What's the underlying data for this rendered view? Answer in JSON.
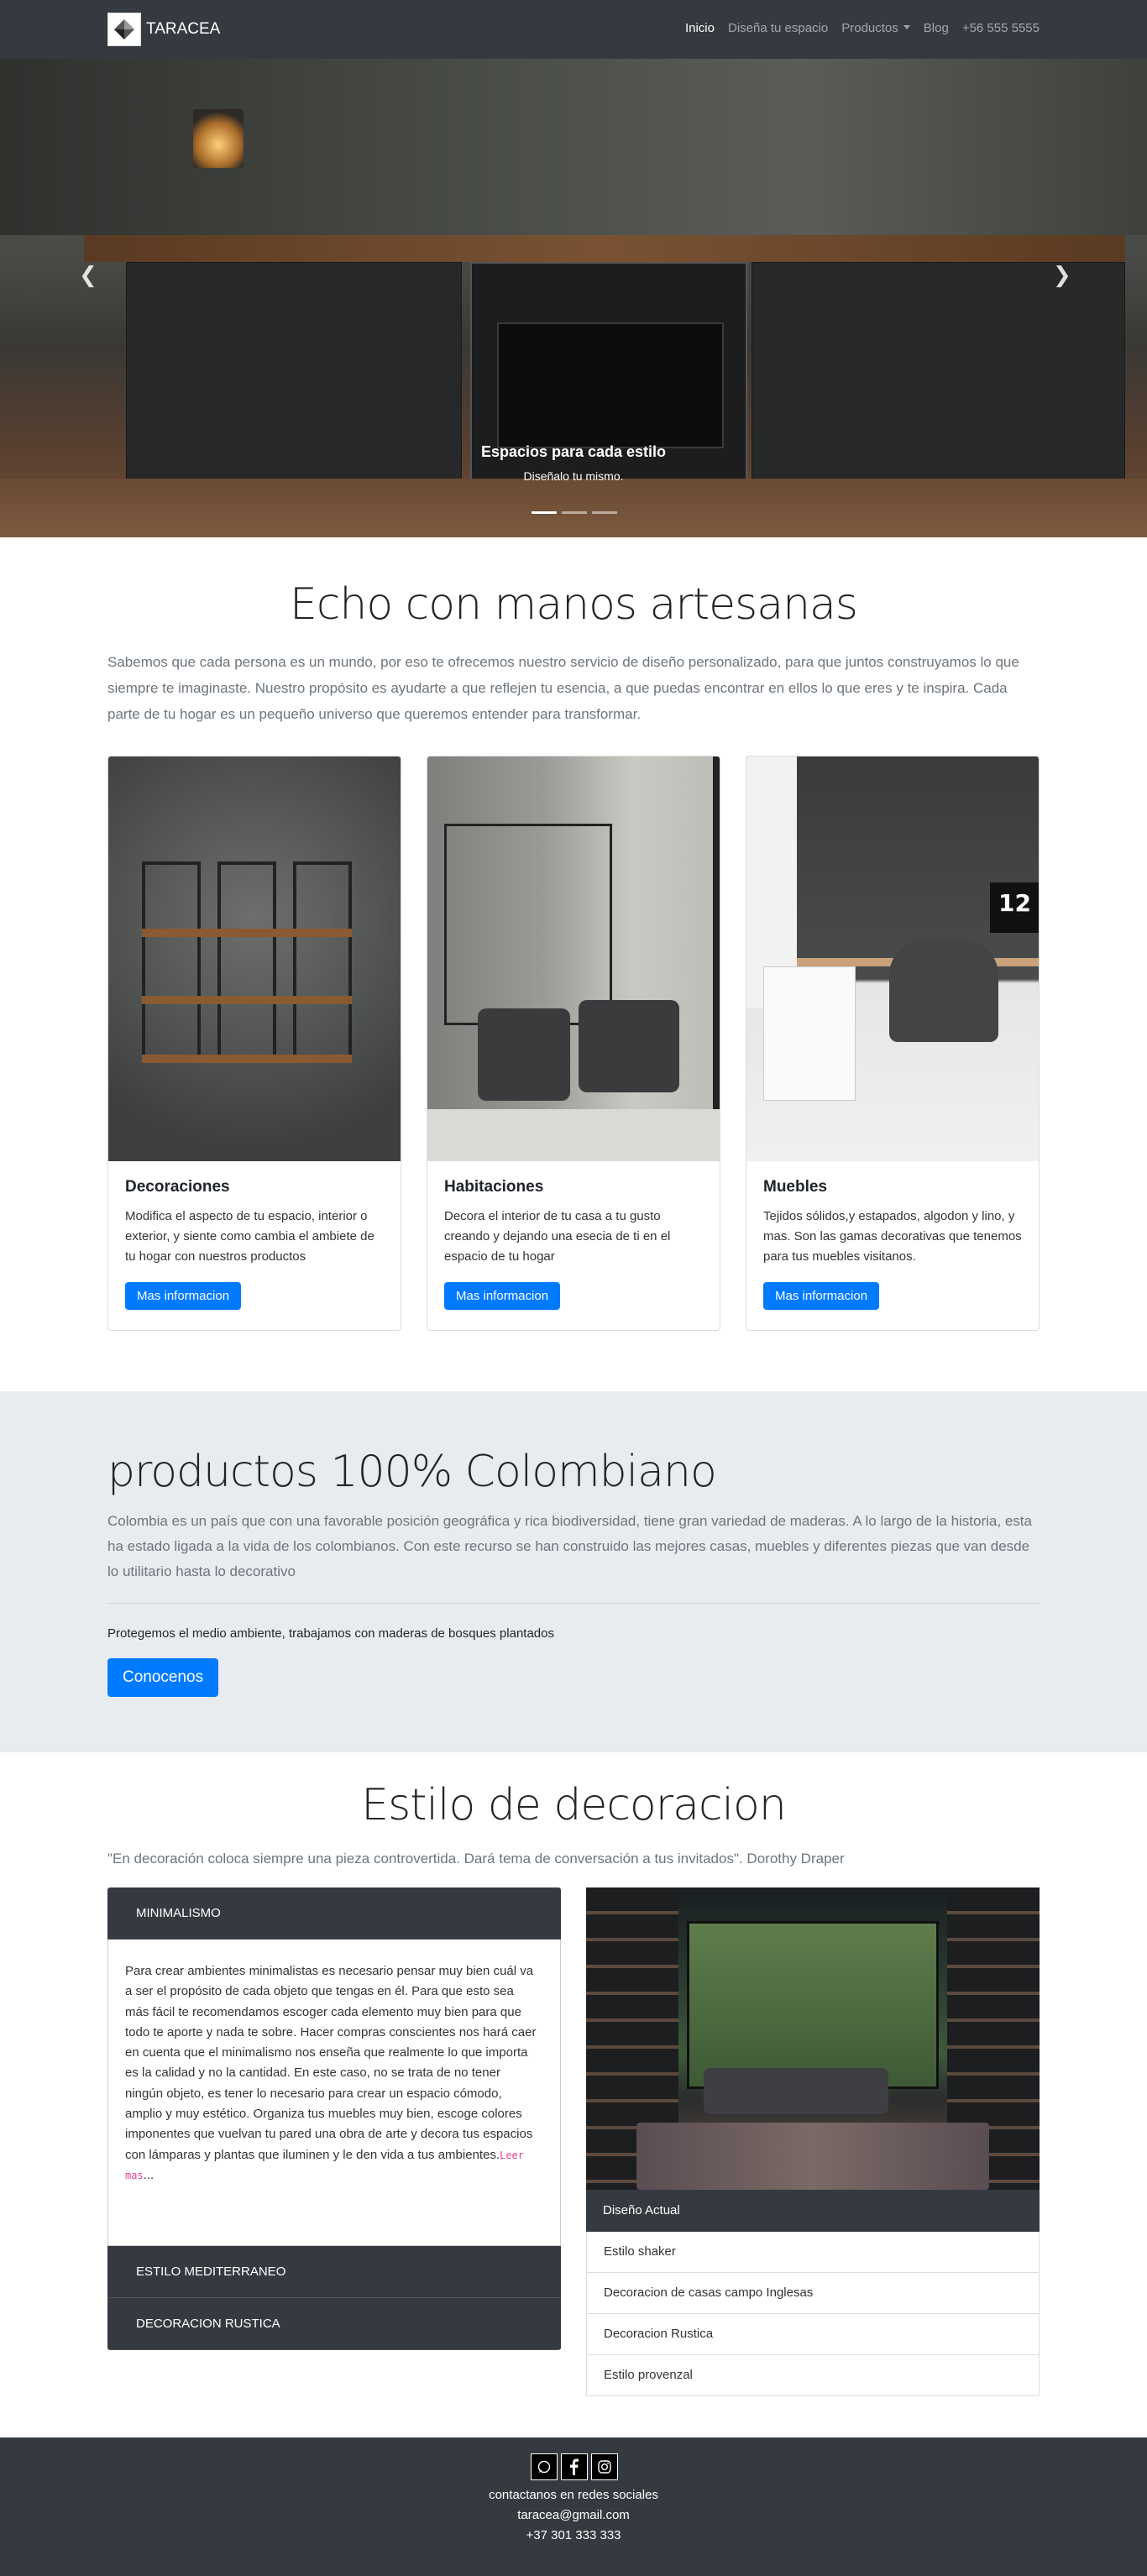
{
  "navbar": {
    "brand": "TARACEA",
    "links": [
      {
        "label": "Inicio",
        "active": true
      },
      {
        "label": "Diseña tu espacio",
        "active": false
      },
      {
        "label": "Productos",
        "active": false,
        "dropdown": true
      },
      {
        "label": "Blog",
        "active": false
      },
      {
        "label": "+56 555 5555",
        "active": false
      }
    ]
  },
  "carousel": {
    "caption_title": "Espacios para cada estilo",
    "caption_text": "Diseñalo tu mismo.",
    "slides": 3,
    "active_slide": 1,
    "prev_icon": "chevron-left-icon",
    "next_icon": "chevron-right-icon"
  },
  "intro": {
    "title": "Echo con manos artesanas",
    "text": "Sabemos que cada persona es un mundo, por eso te ofrecemos nuestro servicio de diseño personalizado, para que juntos construyamos lo que siempre te imaginaste. Nuestro propósito es ayudarte a que reflejen tu esencia, a que puedas encontrar en ellos lo que eres y te inspira. Cada parte de tu hogar es un pequeño universo que queremos entender para transformar."
  },
  "cards": [
    {
      "title": "Decoraciones",
      "text": "Modifica el aspecto de tu espacio, interior o exterior, y siente como cambia el ambiete de tu hogar con nuestros productos",
      "button": "Mas informacion"
    },
    {
      "title": "Habitaciones",
      "text": "Decora el interior de tu casa a tu gusto creando y dejando una esecia de ti en el espacio de tu hogar",
      "button": "Mas informacion"
    },
    {
      "title": "Muebles",
      "text": "Tejidos sólidos,y estapados, algodon y lino, y mas. Son las gamas decorativas que tenemos para tus muebles visitanos.",
      "button": "Mas informacion"
    }
  ],
  "jumbotron": {
    "title": "productos 100% Colombiano",
    "text": "Colombia es un país que con una favorable posición geográfica y rica biodiversidad, tiene gran variedad de maderas. A lo largo de la historia, esta ha estado ligada a la vida de los colombianos. Con este recurso se han construido las mejores casas, muebles y diferentes piezas que van desde lo utilitario hasta lo decorativo",
    "small": "Protegemos el medio ambiente, trabajamos con maderas de bosques plantados",
    "button": "Conocenos"
  },
  "decoration": {
    "title": "Estilo de decoracion",
    "quote": "\"En decoración coloca siempre una pieza controvertida. Dará tema de conversación a tus invitados\". Dorothy Draper",
    "accordion": [
      {
        "title": "MINIMALISMO",
        "body": "Para crear ambientes minimalistas es necesario pensar muy bien cuál va a ser el propósito de cada objeto que tengas en él. Para que esto sea más fácil te recomendamos escoger cada elemento muy bien para que todo te aporte y nada te sobre. Hacer compras conscientes nos hará caer en cuenta que el minimalismo nos enseña que realmente lo que importa es la calidad y no la cantidad. En este caso, no se trata de no tener ningún objeto, es tener lo necesario para crear un espacio cómodo, amplio y muy estético. Organiza tus muebles muy bien, escoge colores imponentes que vuelvan tu pared una obra de arte y decora tus espacios con lámparas y plantas que iluminen y le den vida a tus ambientes.",
        "more": "Leer mas",
        "ellipsis": "..."
      },
      {
        "title": "ESTILO MEDITERRANEO"
      },
      {
        "title": "DECORACION RUSTICA"
      }
    ],
    "list_header": "Diseño Actual",
    "list_items": [
      "Estilo shaker",
      "Decoracion de casas campo Inglesas",
      "Decoracion Rustica",
      "Estilo provenzal"
    ]
  },
  "footer": {
    "social_icons": [
      "whatsapp-icon",
      "facebook-icon",
      "instagram-icon"
    ],
    "contact_label": "contactanos en redes sociales",
    "email": "taracea@gmail.com",
    "phone": "+37 301 333 333"
  }
}
